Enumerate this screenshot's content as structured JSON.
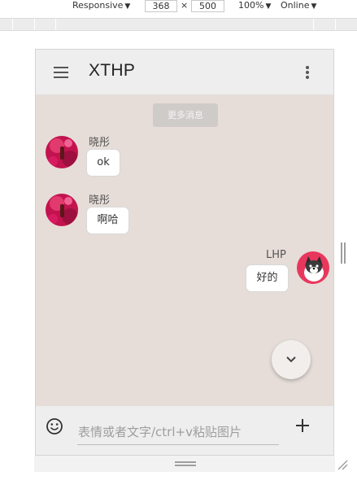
{
  "devtools": {
    "device_label": "Responsive",
    "width_value": "368",
    "times_sign": "×",
    "height_value": "500",
    "zoom_label": "100%",
    "network_label": "Online",
    "dropdown_glyph": "▼"
  },
  "app": {
    "title": "XTHP",
    "load_more_label": "更多消息"
  },
  "messages": [
    {
      "sender": "晓彤",
      "text": "ok",
      "side": "left"
    },
    {
      "sender": "晓彤",
      "text": "啊哈",
      "side": "left"
    },
    {
      "sender": "LHP",
      "text": "好的",
      "side": "right"
    }
  ],
  "composer": {
    "placeholder": "表情或者文字/ctrl+v粘贴图片"
  },
  "icons": {
    "menu": "hamburger-menu-icon",
    "more": "more-vert-icon",
    "scroll_down": "chevron-down-icon",
    "emoji": "emoji-smile-icon",
    "add": "plus-icon"
  },
  "colors": {
    "chat_background": "#e6ddd8",
    "app_bar": "#eeeeee",
    "bubble": "#ffffff",
    "load_more_button": "#cfcbc9"
  }
}
